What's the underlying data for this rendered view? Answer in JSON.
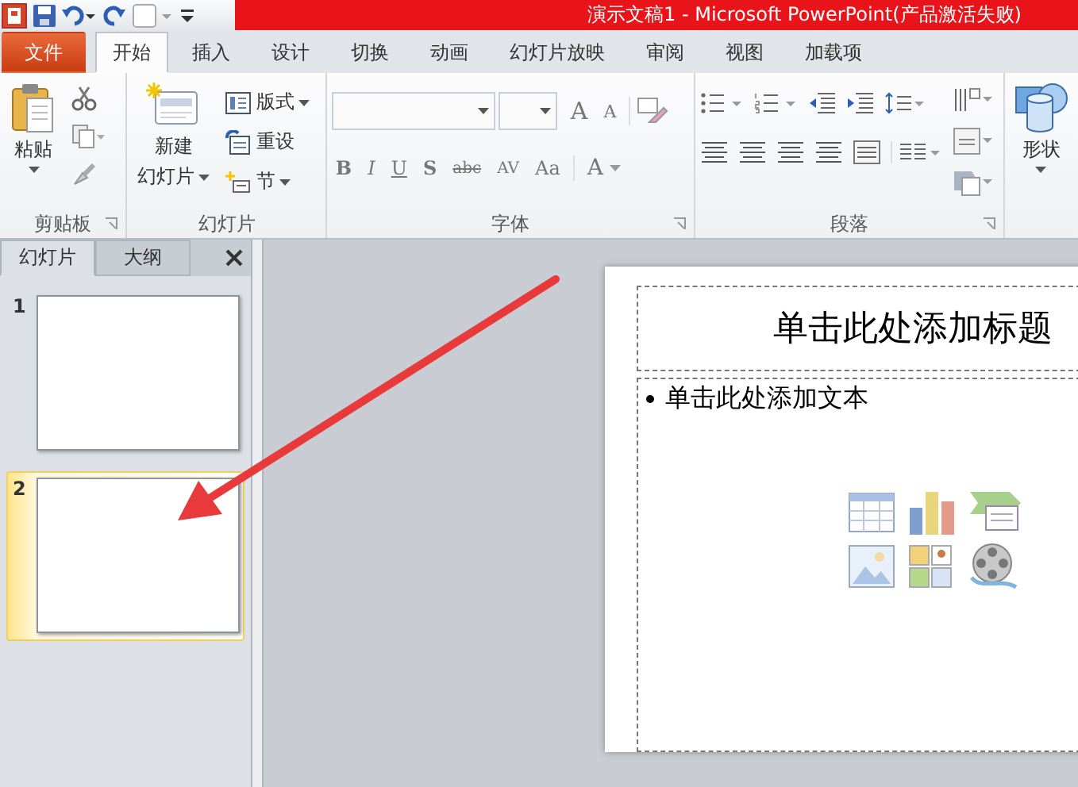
{
  "window": {
    "title": "演示文稿1  -  Microsoft PowerPoint(产品激活失败)"
  },
  "tabs": [
    {
      "label": "文件",
      "kind": "file",
      "selected": false
    },
    {
      "label": "开始",
      "kind": "tab",
      "selected": true
    },
    {
      "label": "插入",
      "kind": "tab",
      "selected": false
    },
    {
      "label": "设计",
      "kind": "tab",
      "selected": false
    },
    {
      "label": "切换",
      "kind": "tab",
      "selected": false
    },
    {
      "label": "动画",
      "kind": "tab",
      "selected": false
    },
    {
      "label": "幻灯片放映",
      "kind": "tab",
      "selected": false
    },
    {
      "label": "审阅",
      "kind": "tab",
      "selected": false
    },
    {
      "label": "视图",
      "kind": "tab",
      "selected": false
    },
    {
      "label": "加载项",
      "kind": "tab",
      "selected": false
    }
  ],
  "ribbon": {
    "clipboard": {
      "label": "剪贴板",
      "paste": "粘贴"
    },
    "slides": {
      "label": "幻灯片",
      "new_slide": [
        "新建",
        "幻灯片"
      ],
      "layout": "版式",
      "reset": "重设",
      "section": "节"
    },
    "font": {
      "label": "字体",
      "size_buttons": [
        "A",
        "A"
      ],
      "format_buttons": [
        "B",
        "I",
        "U",
        "S",
        "abc",
        "AV",
        "Aa"
      ],
      "color_button": "A"
    },
    "paragraph": {
      "label": "段落"
    },
    "shapes": {
      "label": "形状"
    }
  },
  "slide_panel": {
    "tabs": [
      {
        "label": "幻灯片",
        "selected": true
      },
      {
        "label": "大纲",
        "selected": false
      }
    ],
    "thumbnails": [
      {
        "number": "1",
        "selected": false
      },
      {
        "number": "2",
        "selected": true
      }
    ]
  },
  "slide": {
    "title_placeholder": "单击此处添加标题",
    "body_placeholder": "单击此处添加文本"
  }
}
